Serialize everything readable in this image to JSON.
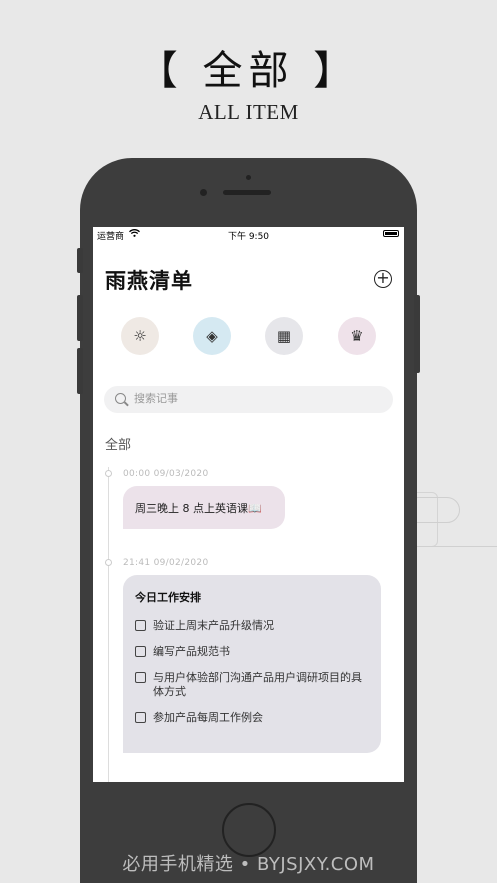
{
  "promo": {
    "title": "【 全部 】",
    "subtitle": "ALL ITEM"
  },
  "status_bar": {
    "carrier": "运营商",
    "wifi_icon": "wifi-icon",
    "time": "下午 9:50",
    "battery_icon": "battery-icon"
  },
  "app": {
    "title": "雨燕清单",
    "add_icon": "plus-circle-icon"
  },
  "categories": [
    {
      "icon": "sun-icon",
      "glyph": "☼",
      "color": "#efe9e4"
    },
    {
      "icon": "layers-icon",
      "glyph": "◈",
      "color": "#d5e9f2"
    },
    {
      "icon": "calendar-icon",
      "glyph": "▦",
      "color": "#e6e6ea"
    },
    {
      "icon": "crown-icon",
      "glyph": "♛",
      "color": "#efe2ea"
    }
  ],
  "search": {
    "placeholder": "搜索记事"
  },
  "section_label": "全部",
  "notes": [
    {
      "timestamp": "00:00 09/03/2020",
      "text": "周三晚上 8 点上英语课📖"
    },
    {
      "timestamp": "21:41 09/02/2020",
      "title": "今日工作安排",
      "todos": [
        "验证上周末产品升级情况",
        "编写产品规范书",
        "与用户体验部门沟通产品用户调研项目的具体方式",
        "参加产品每周工作例会"
      ]
    }
  ],
  "watermark": "必用手机精选 • BYJSJXY.COM"
}
